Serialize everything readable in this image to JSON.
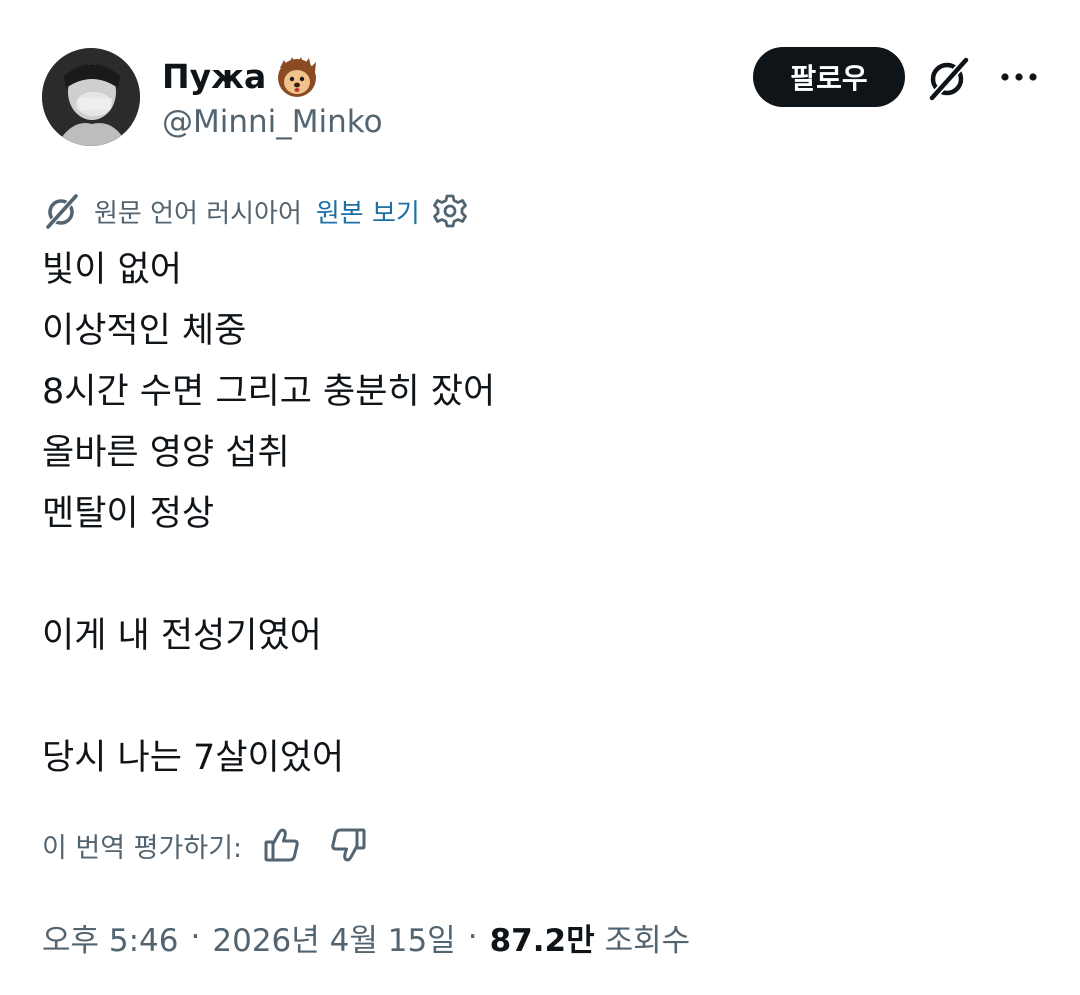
{
  "author": {
    "display_name": "Пужа",
    "name_emoji": "hedgehog-emoji",
    "handle": "@Minni_Minko"
  },
  "actions": {
    "follow_label": "팔로우",
    "grok_icon": "grok-icon",
    "more_icon": "more-dots-icon"
  },
  "translation": {
    "language_note": "원문 언어 러시아어",
    "show_original": "원본 보기",
    "translate_icon": "grok-icon",
    "settings_icon": "gear-icon"
  },
  "body": {
    "line_1": "빛이 없어",
    "line_2": "이상적인 체중",
    "line_3": "8시간 수면 그리고 충분히 잤어",
    "line_4": "올바른 영양 섭취",
    "line_5": "멘탈이 정상",
    "line_6": "이게 내 전성기였어",
    "line_7": "당시 나는 7살이었어"
  },
  "rating": {
    "prompt": "이 번역 평가하기:",
    "like_icon": "thumbs-up-icon",
    "dislike_icon": "thumbs-down-icon"
  },
  "meta": {
    "time": "오후 5:46",
    "separator": "·",
    "date": "2026년 4월 15일",
    "views_count": "87.2만",
    "views_label": "조회수"
  },
  "colors": {
    "text_primary": "#0f1419",
    "text_secondary": "#536471",
    "link": "#1d6fa5",
    "follow_bg": "#0f1419",
    "follow_text": "#ffffff"
  }
}
